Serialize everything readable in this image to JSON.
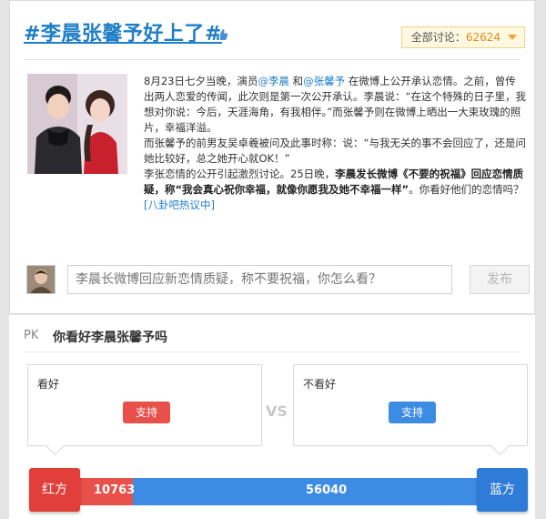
{
  "topic": {
    "title": "#李晨张馨予好上了#",
    "discussion_label": "全部讨论：",
    "discussion_count": "62624"
  },
  "article": {
    "p1": [
      "8月23日七夕当晚，演员",
      "@李晨",
      " 和",
      "@张馨予",
      " 在微博上公开承认恋情。之前，曾传出两人恋爱的传闻，此次则是第一次公开承认。李晨说：“在这个特殊的日子里，我想对你说：今后，天涯海角，有我相伴。”而张馨予则在微博上晒出一大束玫瑰的照片，幸福洋溢。"
    ],
    "p2": "而张馨予的前男友吴卓羲被问及此事时称：说：“与我无关的事不会回应了，还是问她比较好，总之她开心就OK！”",
    "p3": [
      "李张恋情的公开引起激烈讨论。25日晚，",
      "李晨发长微博《不要的祝福》回应恋情质疑，称“我会真心祝你幸福，就像你愿我及她不幸福一样”",
      "。你看好他们的恋情吗？",
      "[八卦吧热议中]"
    ]
  },
  "comment": {
    "placeholder": "李晨长微博回应新恋情质疑，称不要祝福，你怎么看？",
    "publish_label": "发布"
  },
  "pk": {
    "label": "PK",
    "question": "你看好李晨张馨予吗",
    "vs": "VS",
    "left": {
      "label": "看好",
      "button": "支持",
      "side": "红方",
      "count": 10763
    },
    "right": {
      "label": "不看好",
      "button": "支持",
      "side": "蓝方",
      "count": 56040
    }
  },
  "colors": {
    "red": "#e8504a",
    "blue": "#3d8ce4",
    "link": "#1e7ec8",
    "count": "#e38b1d"
  }
}
